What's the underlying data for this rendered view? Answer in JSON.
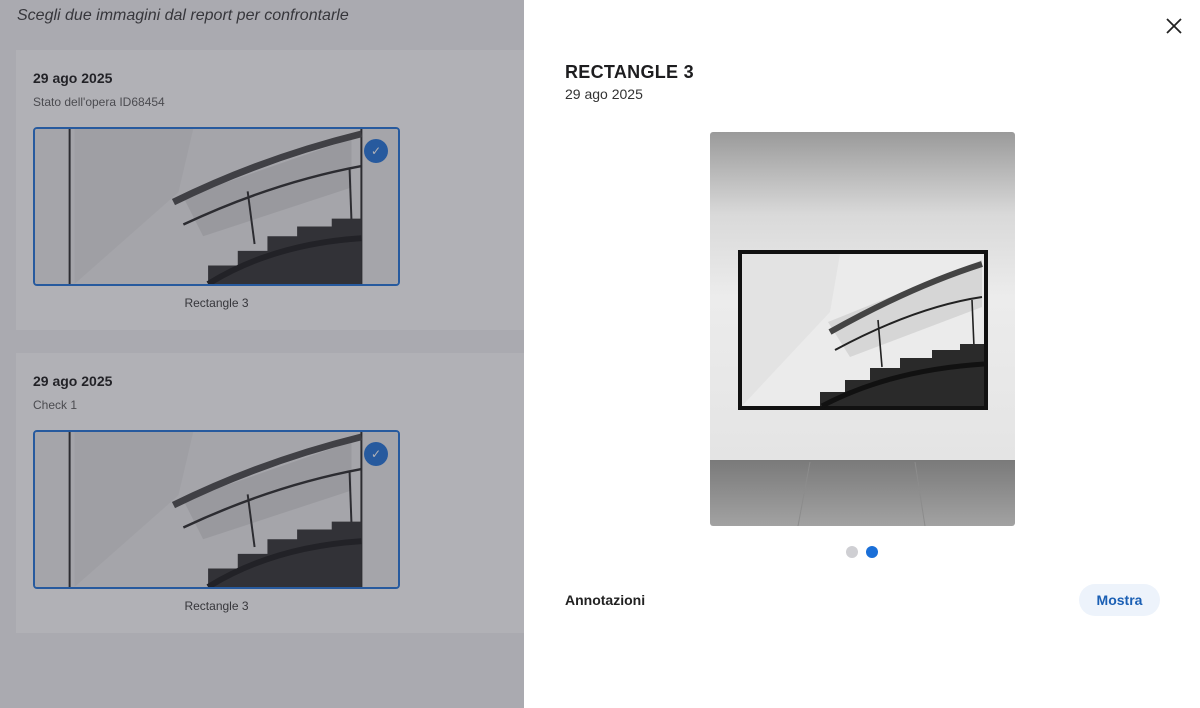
{
  "compare": {
    "heading": "Scegli due immagini dal report per confrontarle",
    "cards": [
      {
        "date": "29 ago 2025",
        "subtitle": "Stato dell'opera ID68454",
        "caption": "Rectangle 3",
        "selected": true
      },
      {
        "date": "29 ago 2025",
        "subtitle": "Check 1",
        "caption": "Rectangle 3",
        "selected": true
      }
    ]
  },
  "detail": {
    "title": "RECTANGLE 3",
    "date": "29 ago 2025",
    "carousel": {
      "total": 2,
      "active_index": 2
    },
    "annotations_label": "Annotazioni",
    "show_button": "Mostra"
  },
  "icons": {
    "close": "close-icon",
    "check": "check-icon"
  },
  "colors": {
    "accent": "#1a6fd8",
    "overlay": "#3c3c48"
  }
}
